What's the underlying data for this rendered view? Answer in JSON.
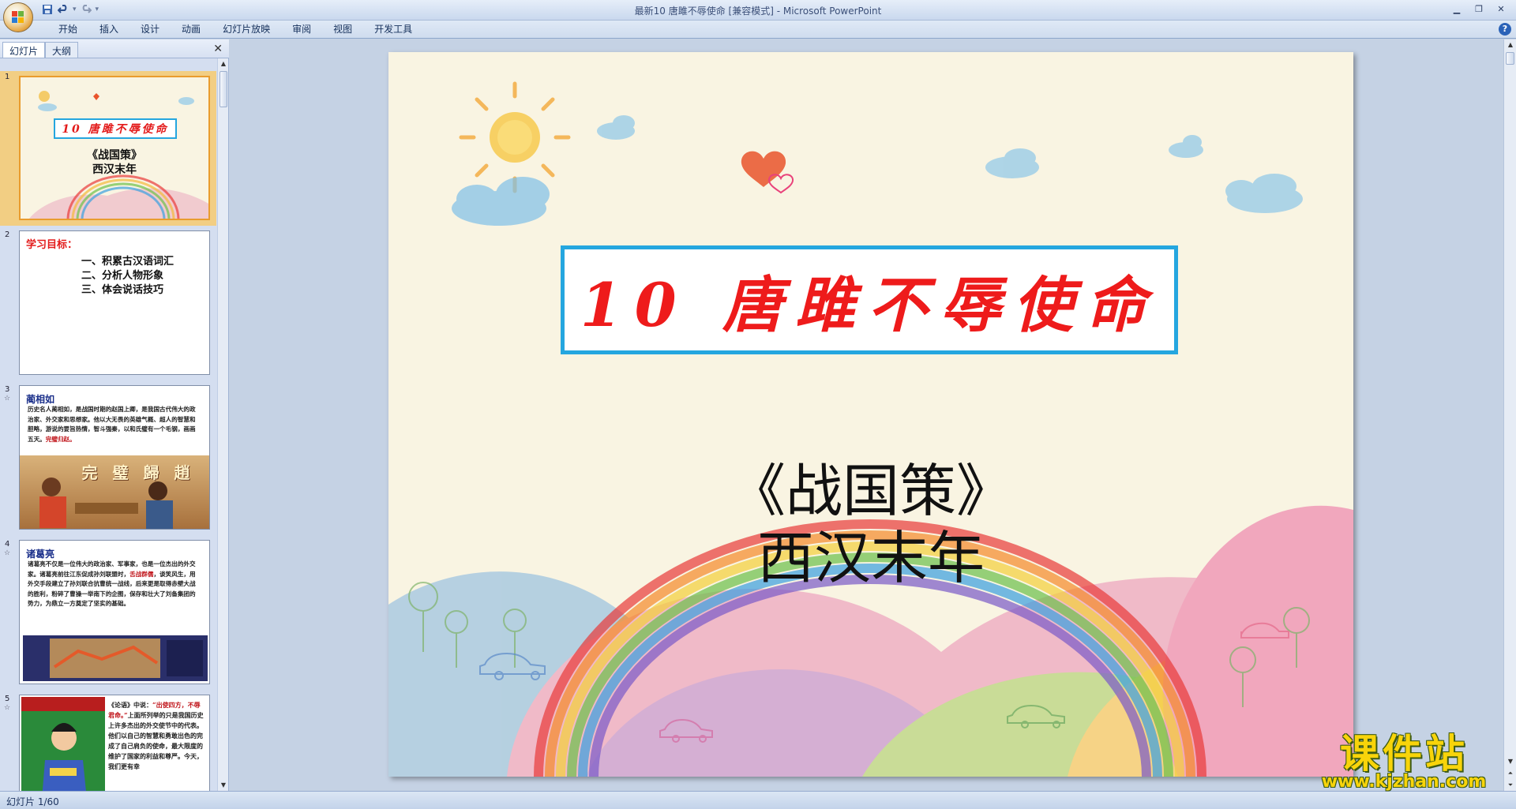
{
  "window": {
    "title": "最新10 唐雎不辱使命 [兼容模式] - Microsoft PowerPoint"
  },
  "ribbon": {
    "tabs": [
      "开始",
      "插入",
      "设计",
      "动画",
      "幻灯片放映",
      "审阅",
      "视图",
      "开发工具"
    ]
  },
  "pane": {
    "tabs": [
      "幻灯片",
      "大纲"
    ],
    "slides": [
      {
        "number": "1",
        "title": "10 唐雎不辱使命",
        "lines": [
          "《战国策》",
          "西汉末年"
        ]
      },
      {
        "number": "2",
        "heading": "学习目标：",
        "items": [
          "一、积累古汉语词汇",
          "二、分析人物形象",
          "三、体会说话技巧"
        ]
      },
      {
        "number": "3",
        "heading": "蔺相如",
        "text": "历史名人蔺相如，是战国时期的赵国上卿，是我国古代伟大的政治家、外交家和思想家。他以大无畏的英雄气概、超人的智慧和胆略，游说的要旨热情，智斗强秦，以和氏璧有一个毛钢，画画五天。",
        "highlight": "完璧归赵。",
        "banner": "完 璧 歸 趙"
      },
      {
        "number": "4",
        "heading": "诸葛亮",
        "text_a": "诸葛亮不仅是一位伟大的政治家、军事家，也是一位杰出的外交家。诸葛亮前往江东促成孙刘联盟时，",
        "highlight": "舌战群儒",
        "text_b": "，谈笑风生，用外交手段建立了孙刘联合抗曹统一战线，后来更是取得赤壁大战的胜利，粉碎了曹操一举南下的企图，保存和壮大了刘备集团的势力，为鼎立一方奠定了坚实的基础。"
      },
      {
        "number": "5",
        "text_a": "《论语》中说：",
        "highlight": "“出使四方，不辱君命。”",
        "text_b": "上面所列举的只是我国历史上许多杰出的外交使节中的代表。他们以自己的智慧和勇敢出色的完成了自己肩负的使命，最大限度的维护了国家的利益和尊严。今天，我们更有幸"
      }
    ]
  },
  "slide": {
    "title": "10 唐雎不辱使命",
    "subtitle_line1": "《战国策》",
    "subtitle_line2": "西汉末年"
  },
  "status": {
    "text": "幻灯片 1/60"
  },
  "watermark": {
    "cn": "课件站",
    "en": "www.kjzhan.com"
  }
}
